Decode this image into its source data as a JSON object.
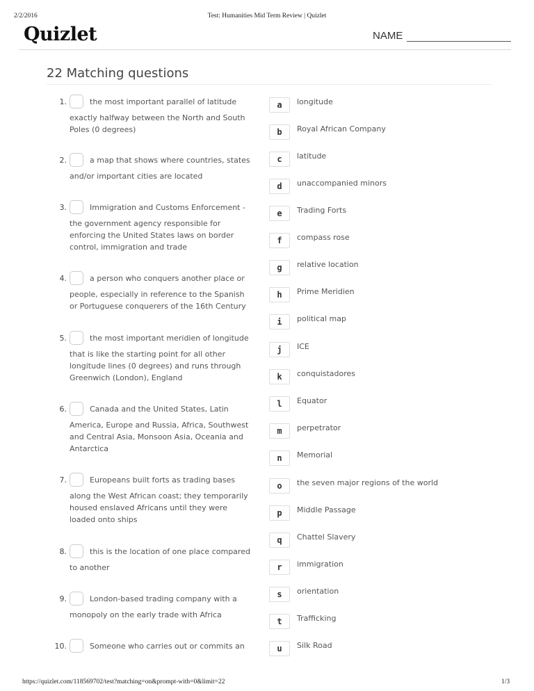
{
  "print_header": {
    "date": "2/2/2016",
    "title": "Test: Humanities Mid Term Review | Quizlet"
  },
  "logo": "Quizlet",
  "name_label": "NAME",
  "section_title": "22 Matching questions",
  "questions": [
    {
      "num": "1.",
      "first": "the most important parallel of latitude",
      "rest": "exactly halfway between the North and South Poles (0 degrees)"
    },
    {
      "num": "2.",
      "first": "a map that shows where countries, states",
      "rest": "and/or important cities are located"
    },
    {
      "num": "3.",
      "first": "Immigration and Customs Enforcement -",
      "rest": "the government agency responsible for enforcing the United States laws on border control, immigration and trade"
    },
    {
      "num": "4.",
      "first": "a person who conquers another place or",
      "rest": "people, especially in reference to the Spanish or Portuguese conquerers of the 16th Century"
    },
    {
      "num": "5.",
      "first": "the most important meridien of longitude",
      "rest": "that is like the starting point for all other longitude lines (0 degrees) and runs through Greenwich (London), England"
    },
    {
      "num": "6.",
      "first": "Canada and the United States, Latin",
      "rest": "America, Europe and Russia, Africa, Southwest and Central Asia, Monsoon Asia, Oceania and Antarctica"
    },
    {
      "num": "7.",
      "first": "Europeans built forts as trading bases",
      "rest": "along the West African coast; they temporarily housed enslaved Africans until they were loaded onto ships"
    },
    {
      "num": "8.",
      "first": "this is the location of one place compared",
      "rest": "to another"
    },
    {
      "num": "9.",
      "first": "London-based trading company with a",
      "rest": "monopoly on the early trade with Africa"
    },
    {
      "num": "10.",
      "first": "Someone who carries out or commits an",
      "rest": ""
    }
  ],
  "answers": [
    {
      "letter": "a",
      "text": "longitude"
    },
    {
      "letter": "b",
      "text": "Royal African Company"
    },
    {
      "letter": "c",
      "text": "latitude"
    },
    {
      "letter": "d",
      "text": "unaccompanied minors"
    },
    {
      "letter": "e",
      "text": "Trading Forts"
    },
    {
      "letter": "f",
      "text": "compass rose"
    },
    {
      "letter": "g",
      "text": "relative location"
    },
    {
      "letter": "h",
      "text": "Prime Meridien"
    },
    {
      "letter": "i",
      "text": "political map"
    },
    {
      "letter": "j",
      "text": "ICE"
    },
    {
      "letter": "k",
      "text": "conquistadores"
    },
    {
      "letter": "l",
      "text": "Equator"
    },
    {
      "letter": "m",
      "text": "perpetrator"
    },
    {
      "letter": "n",
      "text": "Memorial"
    },
    {
      "letter": "o",
      "text": "the seven major regions of the world"
    },
    {
      "letter": "p",
      "text": "Middle Passage"
    },
    {
      "letter": "q",
      "text": "Chattel Slavery"
    },
    {
      "letter": "r",
      "text": "immigration"
    },
    {
      "letter": "s",
      "text": "orientation"
    },
    {
      "letter": "t",
      "text": "Trafficking"
    },
    {
      "letter": "u",
      "text": "Silk Road"
    }
  ],
  "footer": {
    "url": "https://quizlet.com/118569702/test?matching=on&prompt-with=0&limit=22",
    "page": "1/3"
  }
}
